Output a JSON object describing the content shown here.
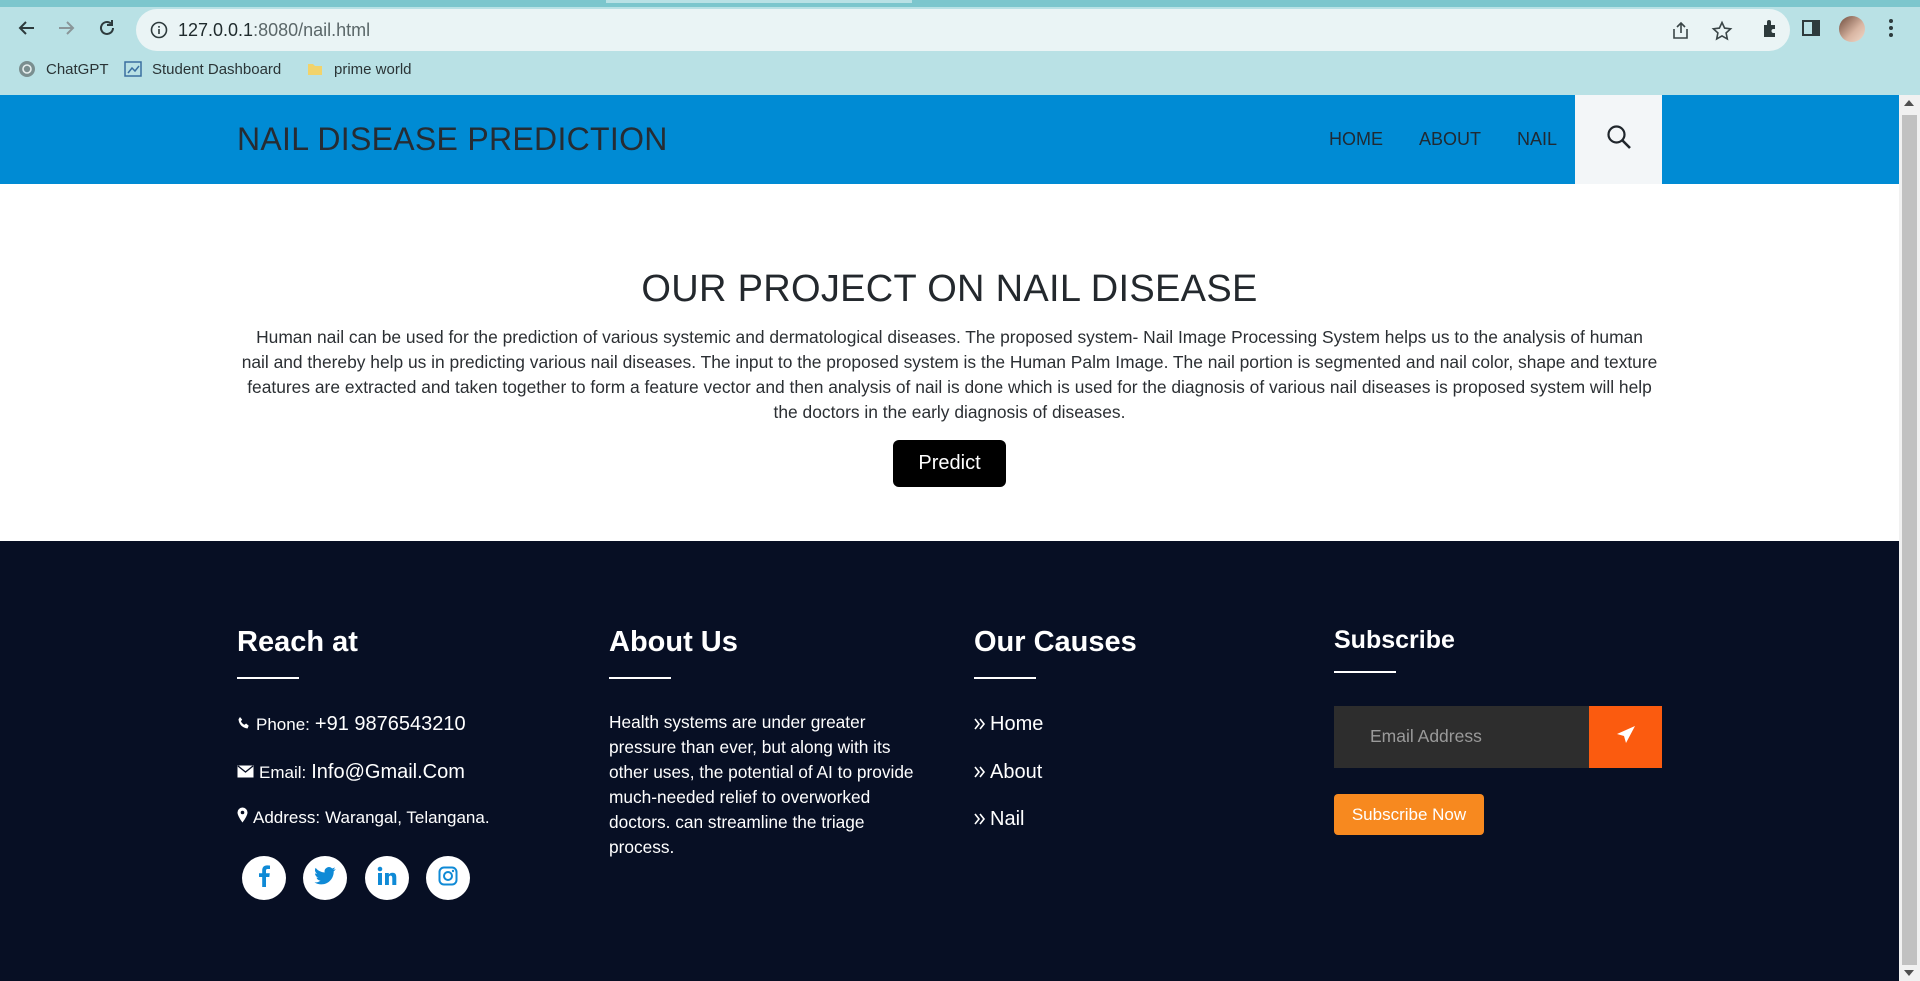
{
  "browser": {
    "url_host": "127.0.0.1",
    "url_rest": ":8080/nail.html",
    "bookmarks": [
      "ChatGPT",
      "Student Dashboard",
      "prime world"
    ]
  },
  "header": {
    "brand": "NAIL DISEASE PREDICTION",
    "menu": [
      "HOME",
      "ABOUT",
      "NAIL"
    ]
  },
  "project": {
    "title": "OUR PROJECT ON NAIL DISEASE",
    "lines": [
      "Human nail can be used for the prediction of various systemic and dermatological diseases. The proposed system- Nail Image Processing System helps us to the analysis of human",
      "nail and thereby help us in predicting various nail diseases. The input to the proposed system is the Human Palm Image. The nail portion is segmented and nail color, shape and texture",
      "features are extracted and taken together to form a feature vector and then analysis of nail is done which is used for the diagnosis of various nail diseases is proposed system will help",
      "the doctors in the early diagnosis of diseases."
    ],
    "button": "Predict"
  },
  "footer": {
    "reach": {
      "heading": "Reach at",
      "phone_label": "Phone:",
      "phone": "+91 9876543210",
      "email_label": "Email:",
      "email": "Info@Gmail.Com",
      "address_label": "Address:",
      "address": "Warangal, Telangana."
    },
    "about": {
      "heading": "About Us",
      "text": "Health systems are under greater pressure than ever, but along with its other uses, the potential of AI to provide much-needed relief to overworked doctors. can streamline the triage process."
    },
    "causes": {
      "heading": "Our Causes",
      "items": [
        "Home",
        "About",
        "Nail"
      ]
    },
    "subscribe": {
      "heading": "Subscribe",
      "placeholder": "Email Address",
      "button": "Subscribe Now"
    }
  },
  "colors": {
    "header_bg": "#008bd4",
    "footer_bg": "#070f24",
    "send_button": "#fb5b0f",
    "subscribe_button": "#f7891f",
    "social_icon": "#0f8ad6"
  }
}
